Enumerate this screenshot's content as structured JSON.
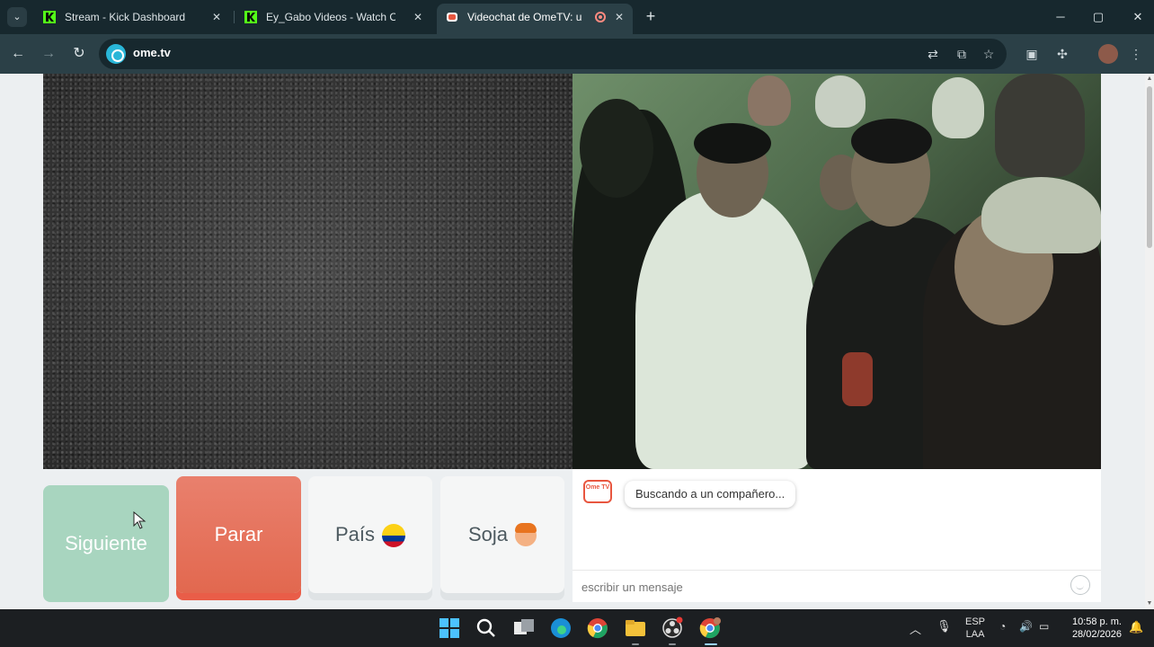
{
  "browser": {
    "tabs": [
      {
        "title": "Stream - Kick Dashboard",
        "active": false
      },
      {
        "title": "Ey_Gabo Videos - Watch On-De",
        "active": false
      },
      {
        "title": "Videochat de OmeTV: una",
        "active": true
      }
    ],
    "url": "ome.tv",
    "window_controls": {
      "minimize": "─",
      "maximize": "▢",
      "close": "✕"
    }
  },
  "ometv": {
    "buttons": {
      "next": "Siguiente",
      "stop": "Parar",
      "country": "País",
      "gender": "Soja"
    },
    "chat": {
      "logo_text": "Ome TV",
      "status_message": "Buscando a un compañero...",
      "input_placeholder": "escribir un mensaje"
    }
  },
  "taskbar": {
    "language": "ESP",
    "layout": "LAA",
    "time": "10:58 p. m.",
    "date": "28/02/2026"
  },
  "colors": {
    "next_button": "#a8d5bf",
    "stop_button": "#e2684f",
    "tab_bar": "#17282e",
    "toolbar": "#2b4047",
    "brand": "#e8563f"
  }
}
